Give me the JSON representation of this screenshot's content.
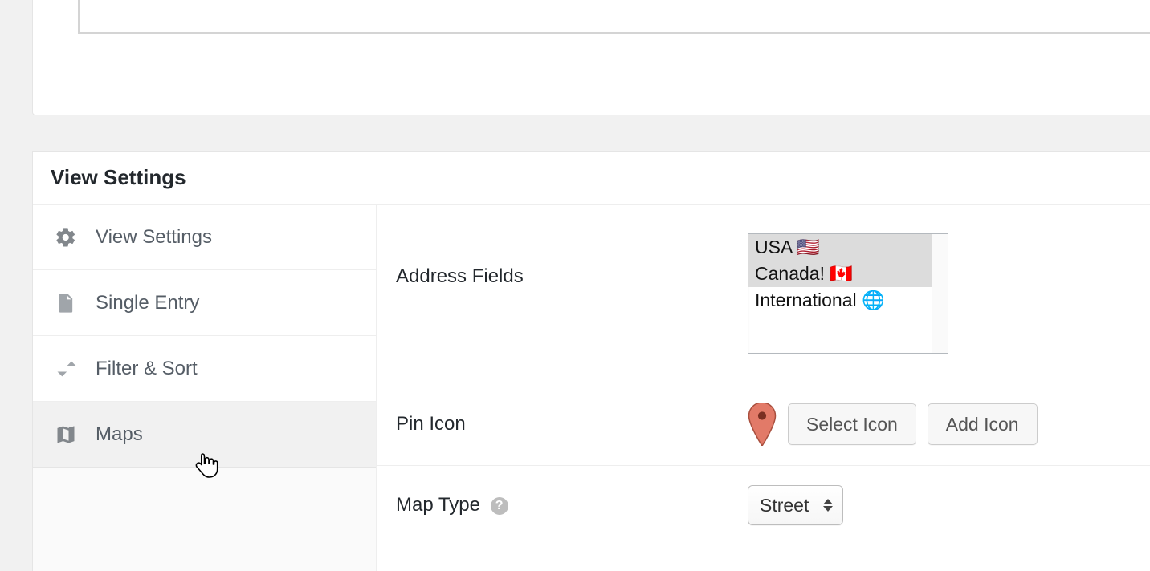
{
  "panel_title": "View Settings",
  "sidebar": {
    "items": [
      {
        "label": "View Settings"
      },
      {
        "label": "Single Entry"
      },
      {
        "label": "Filter & Sort"
      },
      {
        "label": "Maps"
      }
    ]
  },
  "rows": {
    "address": {
      "label": "Address Fields",
      "options": [
        {
          "text": "USA 🇺🇸",
          "selected": true
        },
        {
          "text": "Canada! 🇨🇦",
          "selected": true
        },
        {
          "text": "International 🌐",
          "selected": false
        }
      ]
    },
    "pin": {
      "label": "Pin Icon",
      "select_btn": "Select Icon",
      "add_btn": "Add Icon"
    },
    "maptype": {
      "label": "Map Type",
      "value": "Street"
    }
  }
}
